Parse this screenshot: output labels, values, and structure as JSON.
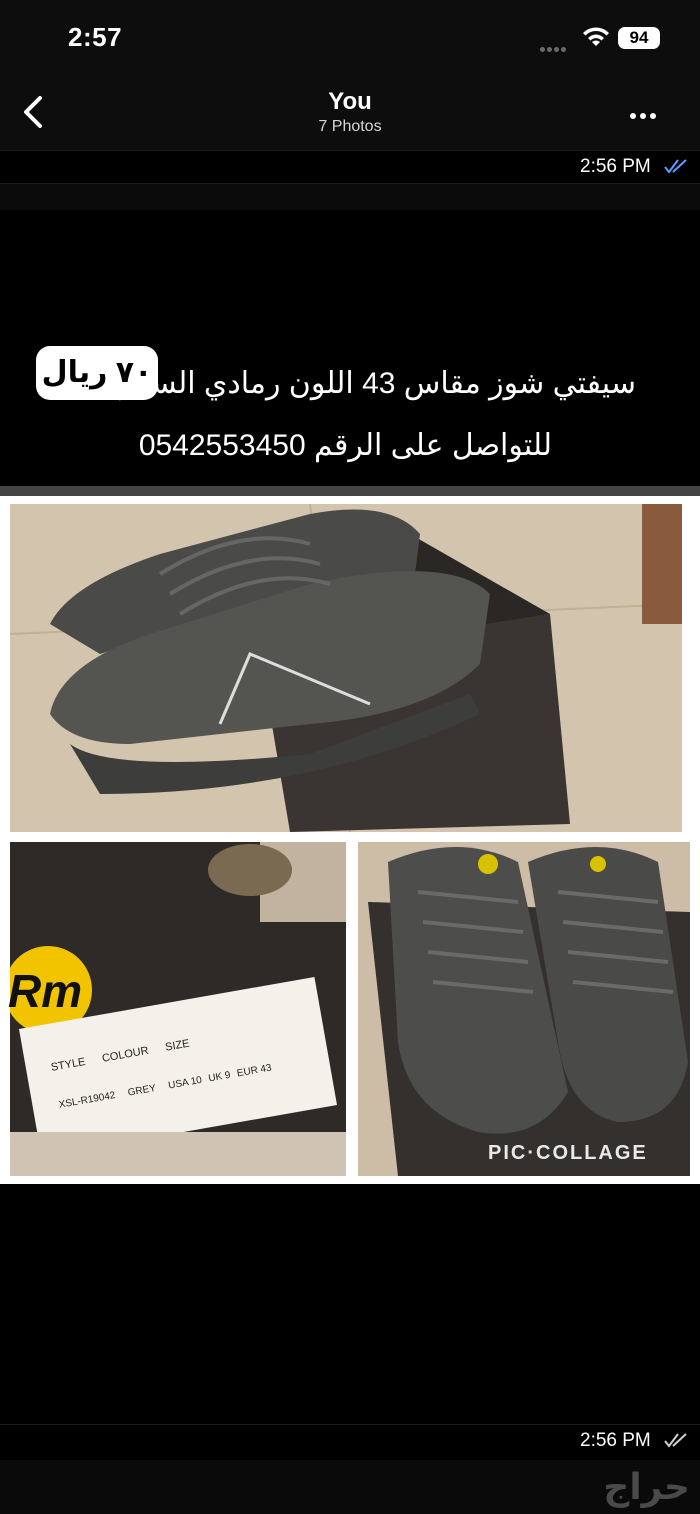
{
  "status_bar": {
    "time": "2:57",
    "battery": "94"
  },
  "header": {
    "title": "You",
    "subtitle": "7 Photos"
  },
  "messages": [
    {
      "time": "2:56 PM"
    },
    {
      "time": "2:56 PM"
    }
  ],
  "photo": {
    "caption_line1": "سيفتي شوز مقاس 43 اللون رمادي السعر",
    "price": "٧٠ ريال",
    "caption_line2": "للتواصل على الرقم 0542553450",
    "box_brand": "Rm",
    "label_headers": [
      "STYLE",
      "COLOUR",
      "SIZE"
    ],
    "label_style": "XSL-R19042",
    "label_colour": "GREY",
    "label_sizes": [
      "USA 10",
      "UK 9",
      "EUR 43"
    ],
    "watermark": "PIC·COLLAGE"
  },
  "brand_logo": "حراج",
  "colors": {
    "accent_ticks": "#5aa0ff",
    "background": "#000000",
    "separator": "#444444"
  },
  "icons": [
    "back-chevron-icon",
    "more-dots-icon",
    "wifi-icon",
    "battery-icon",
    "read-ticks-icon"
  ]
}
